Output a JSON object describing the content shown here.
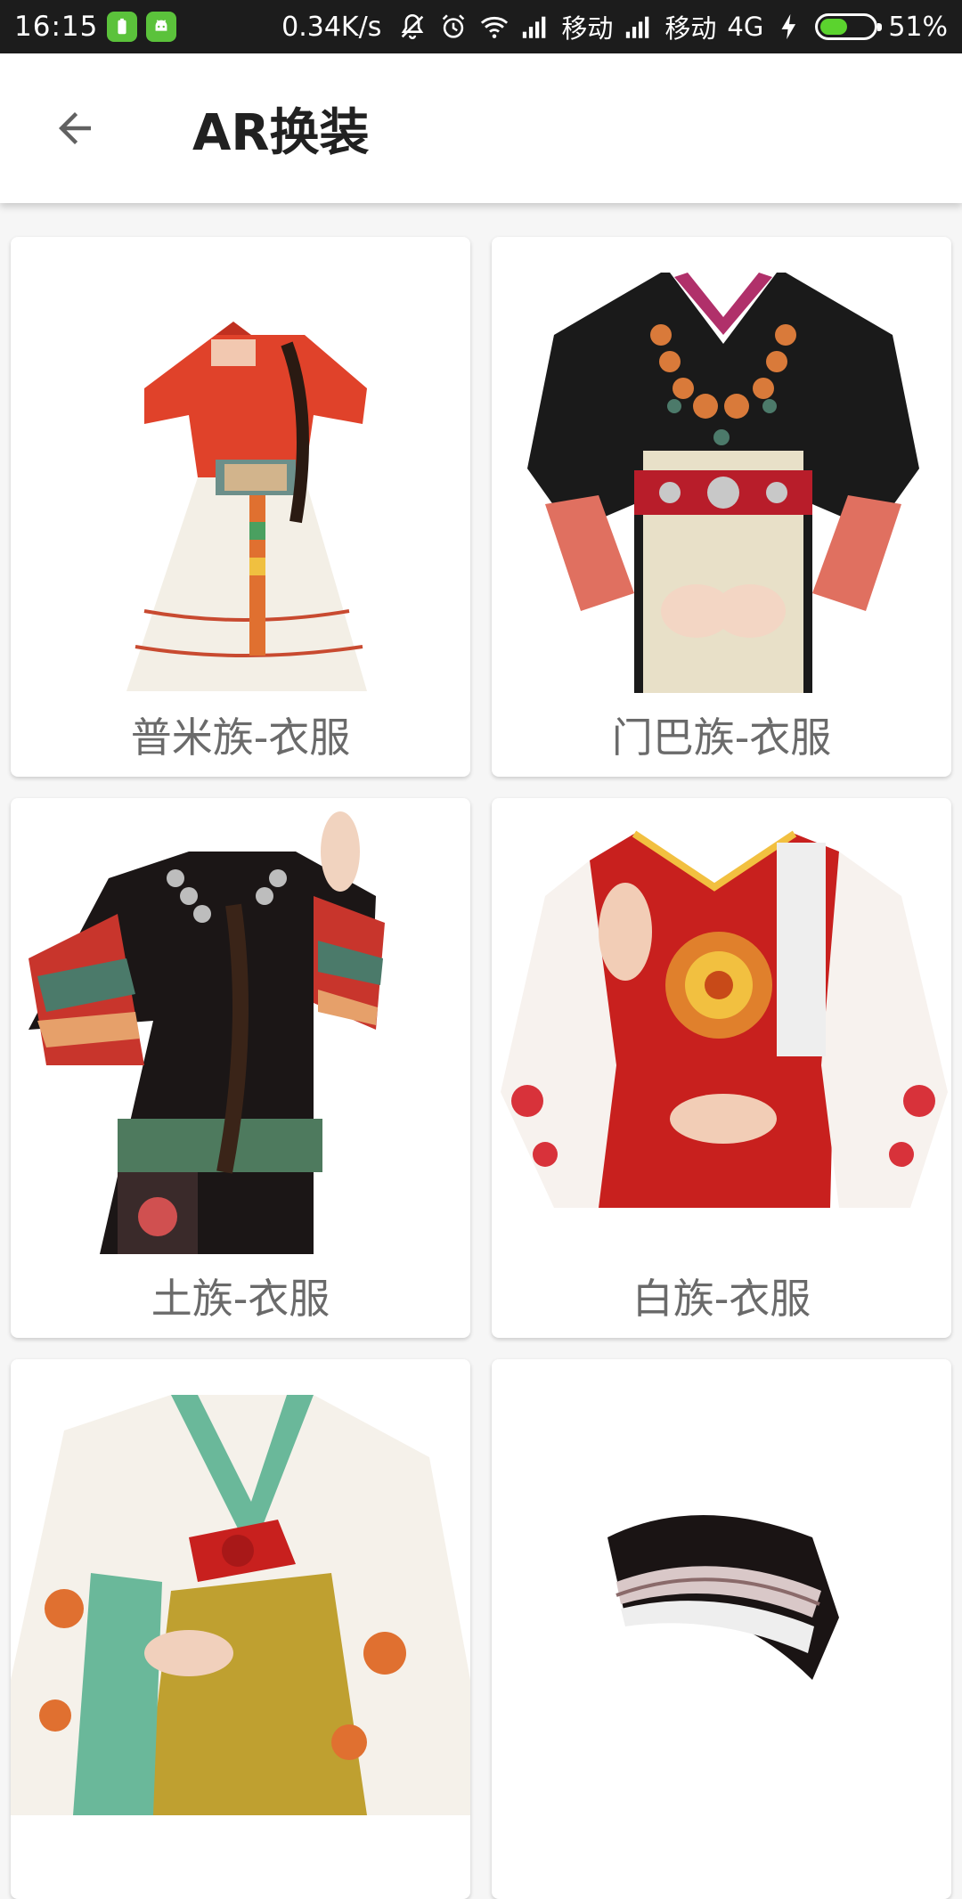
{
  "status_bar": {
    "time": "16:15",
    "net_speed": "0.34K/s",
    "carrier1": "移动",
    "carrier2": "移动",
    "network_type": "4G",
    "battery_percent_label": "51%",
    "battery_level": 0.51
  },
  "app_bar": {
    "title": "AR换装",
    "back_icon": "arrow-back-icon"
  },
  "costumes": [
    {
      "label": "普米族-衣服",
      "icon": "pumi-costume-image"
    },
    {
      "label": "门巴族-衣服",
      "icon": "menba-costume-image"
    },
    {
      "label": "土族-衣服",
      "icon": "tu-costume-image"
    },
    {
      "label": "白族-衣服",
      "icon": "bai-costume-image"
    },
    {
      "label": "",
      "icon": "hanfu-costume-image"
    },
    {
      "label": "",
      "icon": "headband-image"
    }
  ],
  "colors": {
    "status_bar_bg": "#1c1c1c",
    "app_bar_bg": "#ffffff",
    "page_bg": "#f6f6f6",
    "card_label": "#6a6a6a",
    "battery_green": "#5bd32e"
  }
}
